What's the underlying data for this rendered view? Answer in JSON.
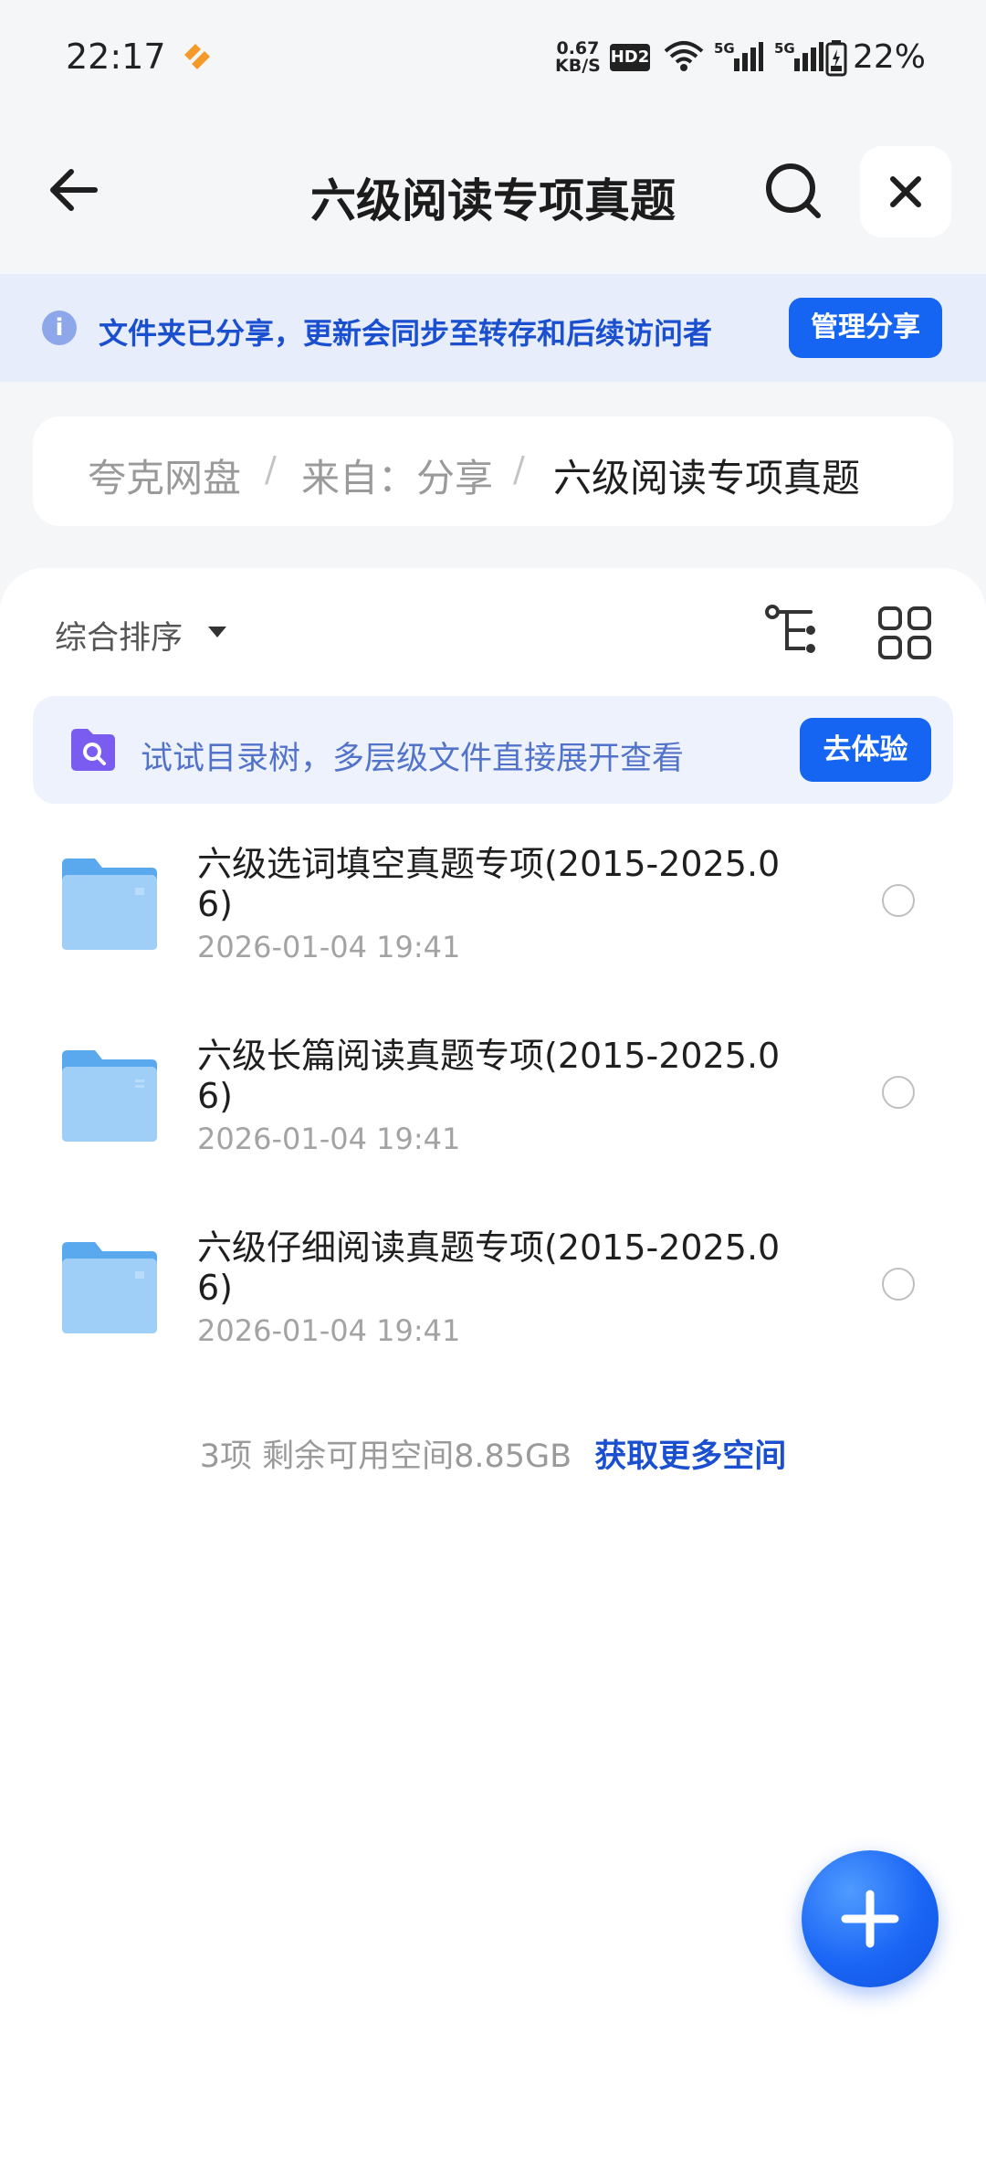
{
  "status_bar": {
    "time": "22:17",
    "net_speed_value": "0.67",
    "net_speed_unit": "KB/S",
    "hd_label": "HD2",
    "signal1_label": "5G",
    "signal2_label": "5G",
    "battery_percent": "22%"
  },
  "nav": {
    "title": "六级阅读专项真题"
  },
  "share_banner": {
    "info_icon": "i",
    "text": "文件夹已分享，更新会同步至转存和后续访问者",
    "button_label": "管理分享"
  },
  "breadcrumb": {
    "items": [
      "夸克网盘",
      "来自：分享",
      "六级阅读专项真题"
    ],
    "separator": "/"
  },
  "toolbar": {
    "sort_label": "综合排序"
  },
  "promo": {
    "text": "试试目录树，多层级文件直接展开查看",
    "button_label": "去体验"
  },
  "files": [
    {
      "name": "六级选词填空真题专项(2015-2025.06)",
      "date": "2026-01-04 19:41"
    },
    {
      "name": "六级长篇阅读真题专项(2015-2025.06)",
      "date": "2026-01-04 19:41"
    },
    {
      "name": "六级仔细阅读真题专项(2015-2025.06)",
      "date": "2026-01-04 19:41"
    }
  ],
  "footer": {
    "count_text": "3项 剩余可用空间8.85GB",
    "link_text": "获取更多空间"
  },
  "colors": {
    "accent": "#1565f2",
    "banner_bg": "#e8edfb",
    "promo_bg": "#eef2fc",
    "folder": "#7fbdf5"
  },
  "icons": {
    "back": "arrow-left-icon",
    "search": "search-icon",
    "close": "close-icon",
    "tree": "directory-tree-icon",
    "grid": "grid-view-icon",
    "fab": "plus-icon"
  }
}
